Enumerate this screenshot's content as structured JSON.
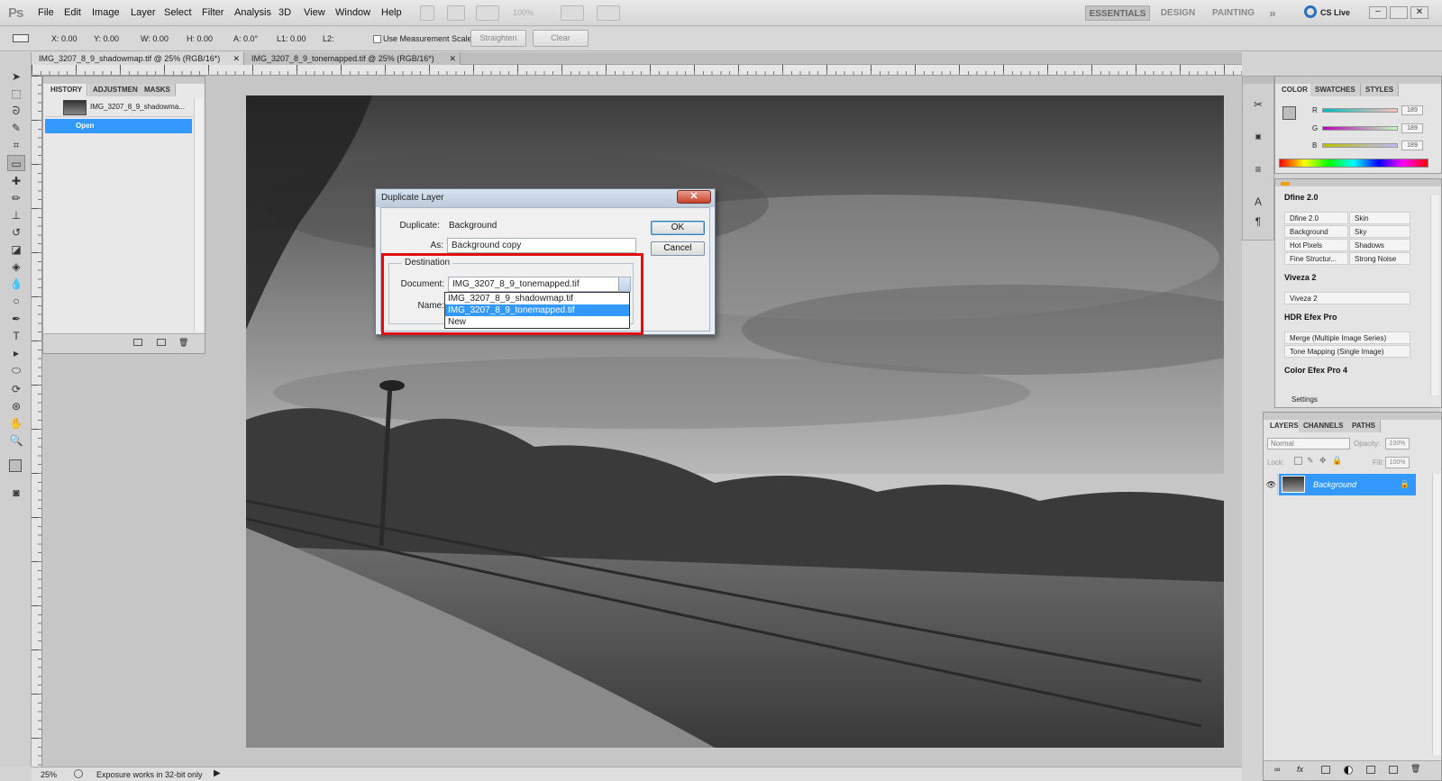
{
  "app": {
    "logo": "Ps"
  },
  "menu": [
    "File",
    "Edit",
    "Image",
    "Layer",
    "Select",
    "Filter",
    "Analysis",
    "3D",
    "View",
    "Window",
    "Help"
  ],
  "menubar_right": {
    "zoom": "100%",
    "ws_essentials": "ESSENTIALS",
    "ws_design": "DESIGN",
    "ws_painting": "PAINTING",
    "more": "»",
    "cslive": "CS Live"
  },
  "options": {
    "x": "X: 0.00",
    "y": "Y: 0.00",
    "w": "W: 0.00",
    "h": "H: 0.00",
    "a": "A: 0.0°",
    "l1": "L1: 0.00",
    "l2": "L2:",
    "measurement": "Use Measurement Scale",
    "straighten": "Straighten",
    "clear": "Clear"
  },
  "doc_tabs": [
    "IMG_3207_8_9_shadowmap.tif @ 25% (RGB/16*)",
    "IMG_3207_8_9_tonemapped.tif @ 25% (RGB/16*)"
  ],
  "history": {
    "tabs": [
      "HISTORY",
      "ADJUSTMEN",
      "MASKS"
    ],
    "snapshot": "IMG_3207_8_9_shadowma...",
    "step": "Open"
  },
  "status": {
    "zoom": "25%",
    "info": "Exposure works in 32-bit only"
  },
  "dialog": {
    "title": "Duplicate Layer",
    "close": "✕",
    "duplicate_label": "Duplicate:",
    "duplicate_value": "Background",
    "as_label": "As:",
    "as_value": "Background copy",
    "ok": "OK",
    "cancel": "Cancel",
    "destination": "Destination",
    "document_label": "Document:",
    "document_value": "IMG_3207_8_9_tonemapped.tif",
    "name_label": "Name:",
    "options": [
      "IMG_3207_8_9_shadowmap.tif",
      "IMG_3207_8_9_tonemapped.tif",
      "New"
    ]
  },
  "color_panel": {
    "tabs": [
      "COLOR",
      "SWATCHES",
      "STYLES"
    ],
    "r_label": "R",
    "g_label": "G",
    "b_label": "B",
    "r": "189",
    "g": "189",
    "b": "189"
  },
  "nik": {
    "dfine": "Dfine 2.0",
    "dfine_cells": [
      "Dfine 2.0",
      "Skin",
      "Background",
      "Sky",
      "Hot Pixels",
      "Shadows",
      "Fine Structur...",
      "Strong Noise"
    ],
    "viveza": "Viveza 2",
    "viveza_cell": "Viveza 2",
    "hdr": "HDR Efex Pro",
    "hdr_cells": [
      "Merge (Multiple Image Series)",
      "Tone Mapping (Single Image)"
    ],
    "color_efex": "Color Efex Pro 4",
    "settings": "Settings"
  },
  "layers": {
    "tabs": [
      "LAYERS",
      "CHANNELS",
      "PATHS"
    ],
    "blend": "Normal",
    "opacity_label": "Opacity:",
    "opacity": "100%",
    "lock_label": "Lock:",
    "fill_label": "Fill:",
    "fill": "100%",
    "layer_name": "Background"
  },
  "colors": {
    "selection": "#3399ff",
    "highlight": "#e01010"
  }
}
